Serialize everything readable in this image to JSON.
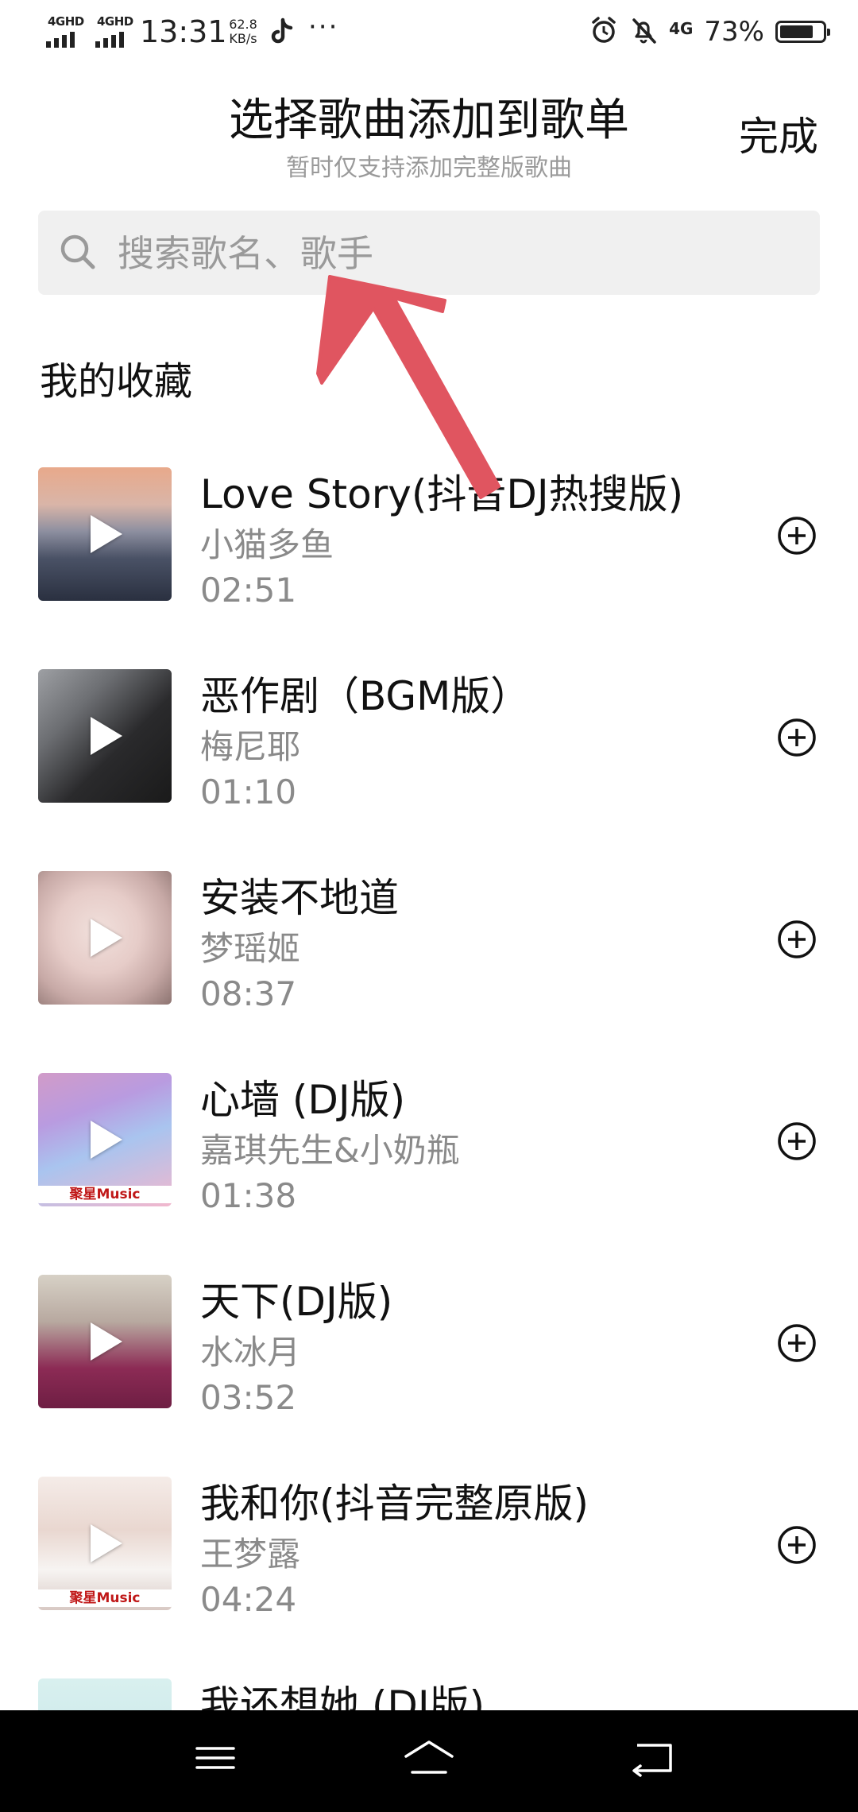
{
  "status_bar": {
    "sim1": "4GHD",
    "sim2": "4GHD",
    "time": "13:31",
    "speed_value": "62.8",
    "speed_unit": "KB/s",
    "more": "···",
    "network": "4G",
    "battery": "73%"
  },
  "header": {
    "title": "选择歌曲添加到歌单",
    "subtitle": "暂时仅支持添加完整版歌曲",
    "done_label": "完成"
  },
  "search": {
    "placeholder": "搜索歌名、歌手",
    "value": ""
  },
  "section": {
    "title": "我的收藏"
  },
  "songs": [
    {
      "title": "Love Story(抖音DJ热搜版)",
      "artist": "小猫多鱼",
      "duration": "02:51"
    },
    {
      "title": "恶作剧（BGM版）",
      "artist": "梅尼耶",
      "duration": "01:10"
    },
    {
      "title": "安装不地道",
      "artist": "梦瑶姬",
      "duration": "08:37"
    },
    {
      "title": "心墙 (DJ版)",
      "artist": "嘉琪先生&小奶瓶",
      "duration": "01:38",
      "cover_brand": "聚星Music"
    },
    {
      "title": "天下(DJ版)",
      "artist": "水冰月",
      "duration": "03:52"
    },
    {
      "title": "我和你(抖音完整原版)",
      "artist": "王梦露",
      "duration": "04:24",
      "cover_brand": "聚星Music"
    },
    {
      "title": "我还想她 (DJ版)",
      "artist": "",
      "duration": ""
    }
  ],
  "icons": {
    "search": "search-icon",
    "add": "add-circle-icon",
    "play": "play-icon",
    "menu": "menu-icon",
    "home": "home-icon",
    "back": "back-icon",
    "annotation": "red-arrow-annotation"
  },
  "colors": {
    "accent_annotation": "#e05560",
    "search_bg": "#f0f0f0",
    "secondary_text": "#8a8a8a"
  }
}
